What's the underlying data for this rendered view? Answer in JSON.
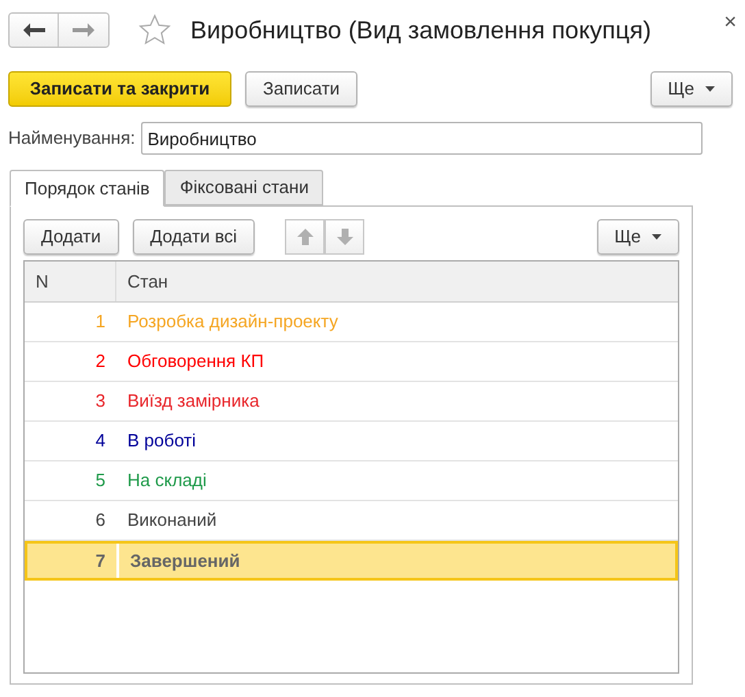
{
  "window": {
    "title": "Виробництво (Вид замовлення покупця)",
    "close": "×",
    "favorite": false
  },
  "toolbar": {
    "buttons": [
      {
        "label": "Записати та закрити",
        "kind": "primary"
      },
      {
        "label": "Записати",
        "kind": "plain"
      }
    ],
    "more": "Ще"
  },
  "name_field": {
    "label": "Найменування:",
    "value": "Виробництво"
  },
  "tabs": [
    {
      "label": "Порядок станів",
      "selected": true
    },
    {
      "label": "Фіксовані стани",
      "selected": false
    }
  ],
  "table_toolbar": {
    "buttons": [
      "Додати",
      "Додати всі"
    ],
    "move_up": {
      "disabled": true
    },
    "move_down": {
      "disabled": true
    },
    "more": "Ще"
  },
  "table": {
    "columns": [
      "N",
      "Стан"
    ],
    "rows": [
      {
        "n": "1",
        "state": "Розробка дизайн-проекту",
        "color": "#f5a623",
        "selected": false
      },
      {
        "n": "2",
        "state": "Обговорення КП",
        "color": "#ff0000",
        "selected": false
      },
      {
        "n": "3",
        "state": "Виїзд замірника",
        "color": "#e8262b",
        "selected": false
      },
      {
        "n": "4",
        "state": "В роботі",
        "color": "#000099",
        "selected": false
      },
      {
        "n": "5",
        "state": "На складі",
        "color": "#1f9a4a",
        "selected": false
      },
      {
        "n": "6",
        "state": "Виконаний",
        "color": "#444444",
        "selected": false
      },
      {
        "n": "7",
        "state": "Завершений",
        "selected": true
      }
    ]
  }
}
